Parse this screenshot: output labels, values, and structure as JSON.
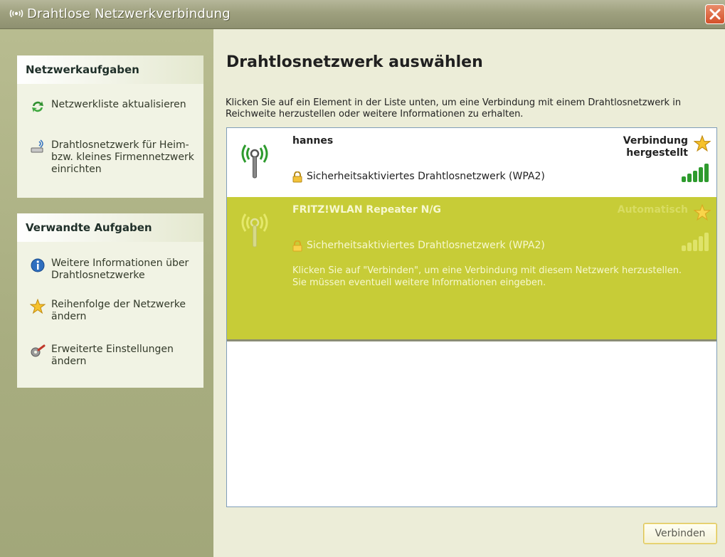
{
  "window": {
    "title": "Drahtlose Netzwerkverbindung",
    "close_glyph": "✕"
  },
  "sidebar": {
    "panels": [
      {
        "header": "Netzwerkaufgaben",
        "items": [
          {
            "label": "Netzwerkliste aktualisieren",
            "icon": "refresh-icon"
          },
          {
            "label": "Drahtlosnetzwerk für Heim- bzw. kleines Firmennetzwerk einrichten",
            "icon": "wireless-setup-icon"
          }
        ]
      },
      {
        "header": "Verwandte Aufgaben",
        "items": [
          {
            "label": "Weitere Informationen über Drahtlosnetzwerke",
            "icon": "info-icon"
          },
          {
            "label": "Reihenfolge der Netzwerke ändern",
            "icon": "star-icon"
          },
          {
            "label": "Erweiterte Einstellungen ändern",
            "icon": "settings-icon"
          }
        ]
      }
    ]
  },
  "main": {
    "title": "Drahtlosnetzwerk auswählen",
    "description": "Klicken Sie auf ein Element in der Liste unten, um eine Verbindung mit einem Drahtlosnetzwerk in Reichweite herzustellen oder weitere Informationen zu erhalten.",
    "networks": [
      {
        "name": "hannes",
        "status": "Verbindung hergestellt",
        "security": "Sicherheitsaktiviertes Drahtlosnetzwerk (WPA2)",
        "signal_bars": 5,
        "selected": false
      },
      {
        "name": "FRITZ!WLAN Repeater N/G",
        "status": "Automatisch",
        "security": "Sicherheitsaktiviertes Drahtlosnetzwerk (WPA2)",
        "hint": "Klicken Sie auf \"Verbinden\", um eine Verbindung mit diesem Netzwerk herzustellen. Sie müssen eventuell weitere Informationen eingeben.",
        "signal_bars": 5,
        "selected": true
      }
    ],
    "connect_button": "Verbinden"
  },
  "colors": {
    "selection": "#c7cc37",
    "sidebar": "#a8ad80",
    "signal": "#2e9b2e"
  }
}
